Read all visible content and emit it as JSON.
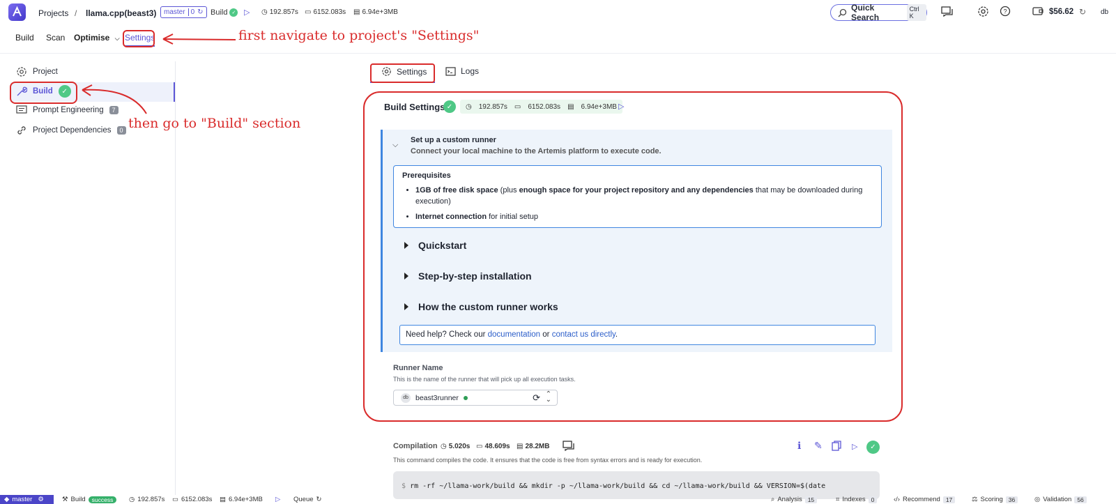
{
  "topbar": {
    "projects": "Projects",
    "separator": "/",
    "project_name": "llama.cpp(beast3)",
    "branch": "master",
    "branch_count": "0",
    "build_label": "Build",
    "time": "192.857s",
    "cpu": "6152.083s",
    "memory": "6.94e+3MB",
    "quick_search": "Quick Search",
    "shortcut": "Ctrl K",
    "balance": "$56.62",
    "user": "db"
  },
  "nav": {
    "build": "Build",
    "scan": "Scan",
    "optimise": "Optimise",
    "settings": "Settings"
  },
  "sidebar": {
    "items": [
      {
        "label": "Project"
      },
      {
        "label": "Build"
      },
      {
        "label": "Prompt Engineering",
        "count": "7"
      },
      {
        "label": "Project Dependencies",
        "count": "0"
      }
    ]
  },
  "tabs": {
    "settings": "Settings",
    "logs": "Logs"
  },
  "build_settings": {
    "title": "Build Settings",
    "time": "192.857s",
    "cpu": "6152.083s",
    "memory": "6.94e+3MB"
  },
  "custom_runner": {
    "title": "Set up a custom runner",
    "subtitle": "Connect your local machine to the Artemis platform to execute code.",
    "prereq_title": "Prerequisites",
    "prereq_1_bold": "1GB of free disk space",
    "prereq_1_mid": " (plus ",
    "prereq_1_bold2": "enough space for your project repository and any dependencies",
    "prereq_1_end": " that may be downloaded during execution)",
    "prereq_2_bold": "Internet connection",
    "prereq_2_end": " for initial setup",
    "accordions": [
      "Quickstart",
      "Step-by-step installation",
      "How the custom runner works"
    ],
    "help_prefix": "Need help? Check our ",
    "help_link1": "documentation",
    "help_mid": " or ",
    "help_link2": "contact us directly",
    "help_end": "."
  },
  "runner": {
    "label": "Runner Name",
    "desc": "This is the name of the runner that will pick up all execution tasks.",
    "avatar": "db",
    "value": "beast3runner"
  },
  "compilation": {
    "label": "Compilation",
    "time": "5.020s",
    "cpu": "48.609s",
    "memory": "28.2MB",
    "desc": "This command compiles the code. It ensures that the code is free from syntax errors and is ready for execution.",
    "prompt": "$",
    "command": "rm -rf ~/llama-work/build && mkdir -p ~/llama-work/build && cd ~/llama-work/build && VERSION=$(date"
  },
  "statusbar": {
    "branch": "master",
    "build": "Build",
    "build_status": "success",
    "time": "192.857s",
    "cpu": "6152.083s",
    "memory": "6.94e+3MB",
    "queue": "Queue",
    "analysis": "Analysis",
    "analysis_count": "15",
    "indexes": "Indexes",
    "indexes_count": "0",
    "recommend": "Recommend",
    "recommend_count": "17",
    "scoring": "Scoring",
    "scoring_count": "36",
    "validation": "Validation",
    "validation_count": "56"
  },
  "annotations": {
    "first": "first navigate to project's \"Settings\"",
    "then": "then go to \"Build\" section"
  },
  "colors": {
    "accent": "#5b55d6",
    "annotation": "#d92b2b",
    "success": "#4fc886",
    "info_border": "#3f86e0"
  }
}
